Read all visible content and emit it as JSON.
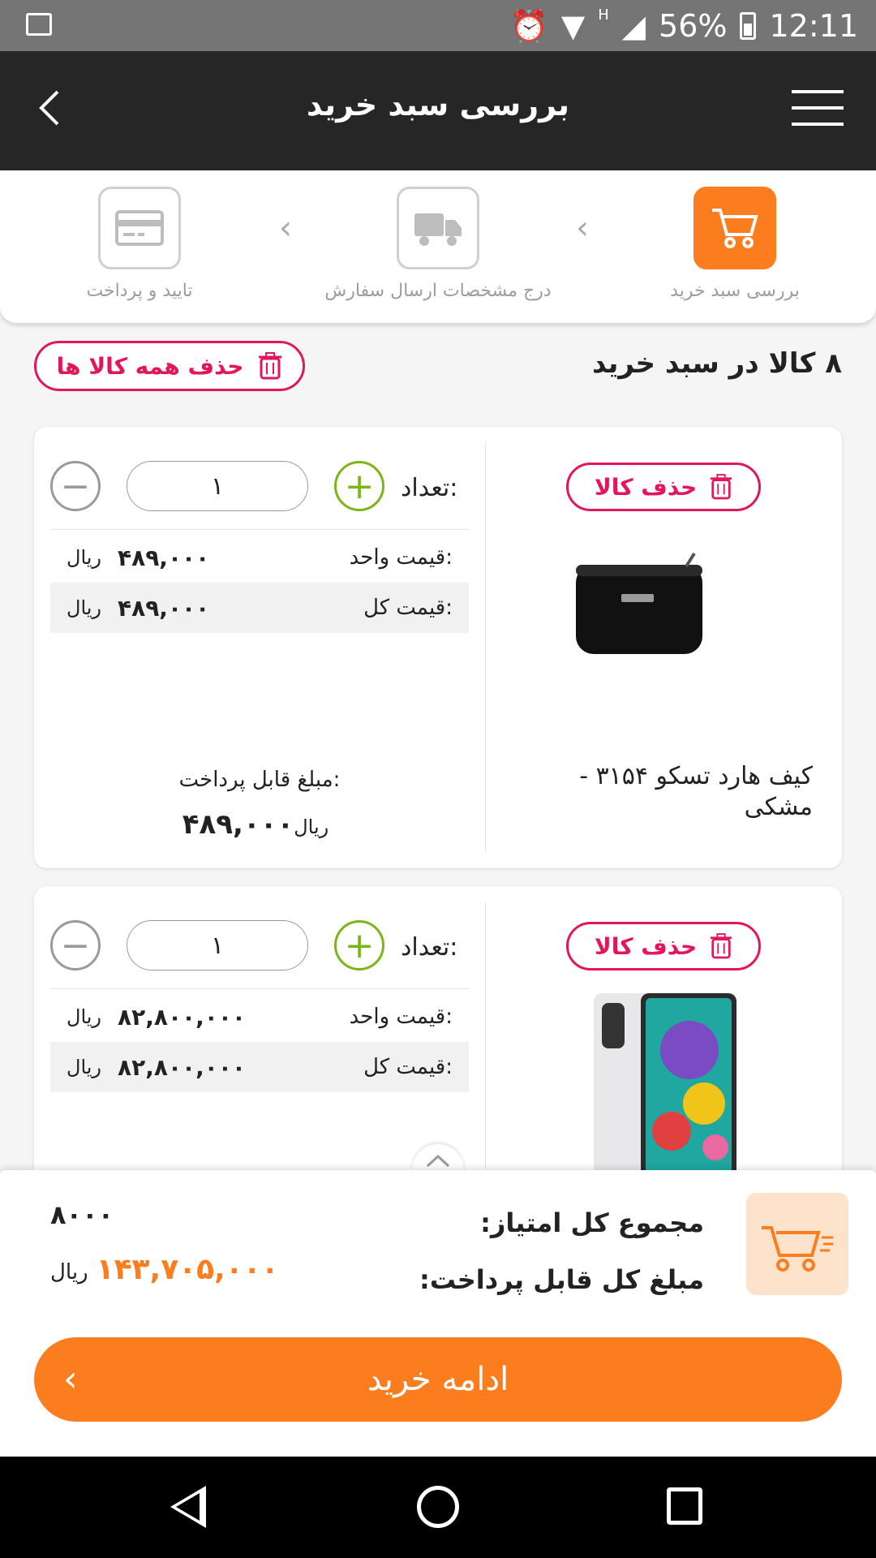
{
  "status_bar": {
    "battery": "56%",
    "time": "12:11",
    "network": "H"
  },
  "app_bar": {
    "title": "بررسی سبد خرید",
    "back_icon": "chevron-left-icon",
    "menu_icon": "hamburger-menu-icon"
  },
  "steps": [
    {
      "label": "بررسی سبد خرید",
      "icon": "cart-icon",
      "active": true
    },
    {
      "label": "درج مشخصات ارسال سفارش",
      "icon": "truck-icon",
      "active": false
    },
    {
      "label": "تایید و پرداخت",
      "icon": "credit-card-icon",
      "active": false
    }
  ],
  "cart": {
    "count_label": "۸ کالا در سبد خرید",
    "delete_all_label": "حذف همه کالا ها"
  },
  "labels": {
    "delete_item": "حذف کالا",
    "quantity": "تعداد:",
    "unit_price": "قیمت واحد:",
    "total_price": "قیمت کل:",
    "payable": "مبلغ قابل پرداخت:",
    "currency": "ریال"
  },
  "items": [
    {
      "name": "کیف هارد تسکو ۳۱۵۴ - مشکی",
      "quantity": "۱",
      "unit_price": "۴۸۹,۰۰۰",
      "total_price": "۴۸۹,۰۰۰",
      "payable": "۴۸۹,۰۰۰"
    },
    {
      "name": "",
      "quantity": "۱",
      "unit_price": "۸۲,۸۰۰,۰۰۰",
      "total_price": "۸۲,۸۰۰,۰۰۰",
      "payable": ""
    }
  ],
  "summary": {
    "points_label": "مجموع کل امتیاز:",
    "points_value": "۸۰۰۰",
    "total_label": "مبلغ کل قابل پرداخت:",
    "total_value": "۱۴۳,۷۰۵,۰۰۰",
    "currency": "ریال",
    "continue_label": "ادامه خرید"
  },
  "colors": {
    "accent": "#fb7d1e",
    "danger": "#e3165b",
    "plus": "#7cb518",
    "appbar": "#262626"
  }
}
